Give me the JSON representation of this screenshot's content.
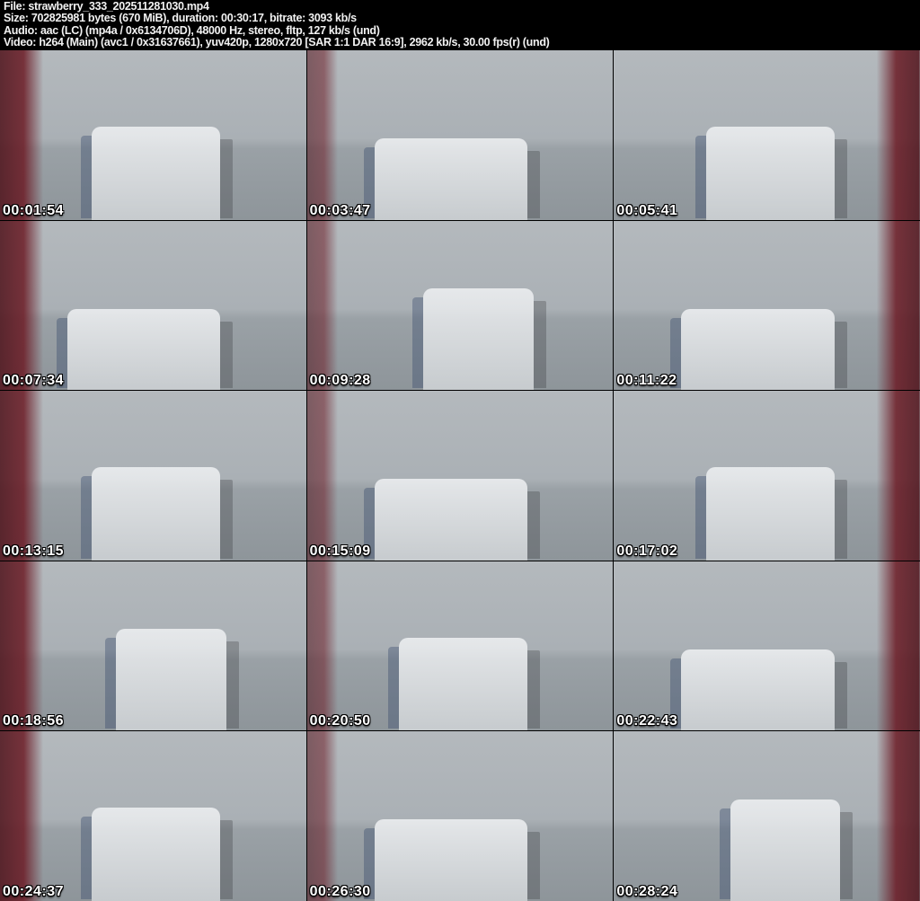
{
  "header": {
    "file_line": "File: strawberry_333_202511281030.mp4",
    "size_line": "Size: 702825981 bytes (670 MiB), duration: 00:30:17, bitrate: 3093 kb/s",
    "audio_line": "Audio: aac (LC) (mp4a / 0x6134706D), 48000 Hz, stereo, fltp, 127 kb/s (und)",
    "video_line": "Video: h264 (Main) (avc1 / 0x31637661), yuv420p, 1280x720 [SAR 1:1 DAR 16:9], 2962 kb/s, 30.00 fps(r) (und)"
  },
  "palette": {
    "header_bg": "#000000",
    "header_text": "#f2f2f2",
    "timestamp_text": "#ffffff",
    "wall_gray": "#b4b9bd",
    "floor_gray": "#8e959a",
    "curtain_red": "#6b1a24",
    "accent_navy": "#2a3e63"
  },
  "grid": {
    "columns": 3,
    "rows": 5
  },
  "thumbnails": [
    {
      "timestamp": "00:01:54"
    },
    {
      "timestamp": "00:03:47"
    },
    {
      "timestamp": "00:05:41"
    },
    {
      "timestamp": "00:07:34"
    },
    {
      "timestamp": "00:09:28"
    },
    {
      "timestamp": "00:11:22"
    },
    {
      "timestamp": "00:13:15"
    },
    {
      "timestamp": "00:15:09"
    },
    {
      "timestamp": "00:17:02"
    },
    {
      "timestamp": "00:18:56"
    },
    {
      "timestamp": "00:20:50"
    },
    {
      "timestamp": "00:22:43"
    },
    {
      "timestamp": "00:24:37"
    },
    {
      "timestamp": "00:26:30"
    },
    {
      "timestamp": "00:28:24"
    }
  ]
}
